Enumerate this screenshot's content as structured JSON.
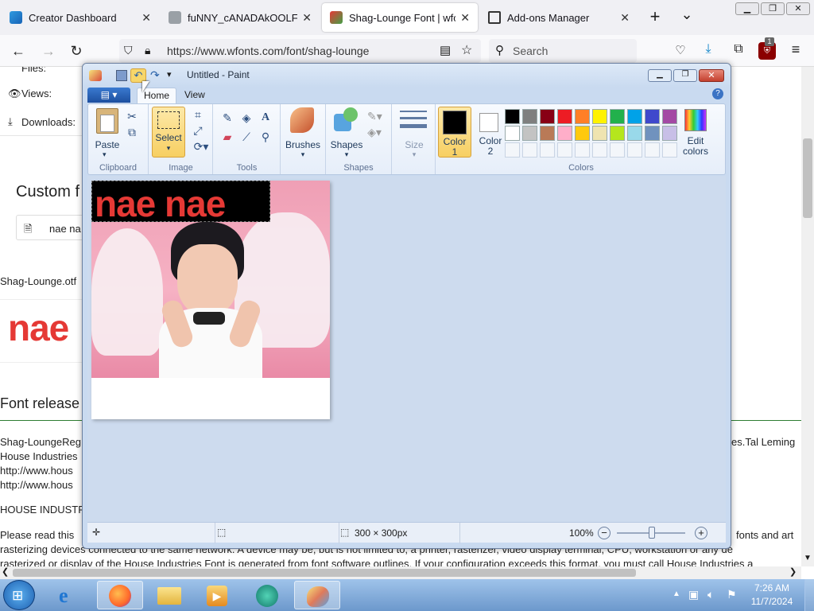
{
  "browser": {
    "tabs": [
      {
        "label": "Creator Dashboard",
        "icon": "windows-icon",
        "active": false
      },
      {
        "label": "fuNNY_cANADAkOOLFEVE",
        "icon": "page-icon",
        "active": false
      },
      {
        "label": "Shag-Lounge Font | wfont",
        "icon": "wfonts-icon",
        "active": true
      },
      {
        "label": "Add-ons Manager",
        "icon": "puzzle-icon",
        "active": false
      }
    ],
    "new_tab": "+",
    "tab_list": "⌄",
    "url": "https://www.wfonts.com/font/shag-lounge",
    "search_placeholder": "Search",
    "extension_badge": "1"
  },
  "page": {
    "files_label": "Files:",
    "views_label": "Views:",
    "downloads_label": "Downloads:",
    "custom_heading": "Custom f",
    "preview_input": "nae na",
    "file_name": "Shag-Lounge.otf",
    "preview_big": "nae",
    "release_heading": "Font release",
    "lines": [
      "Shag-LoungeReg",
      "House Industries",
      "http://www.hous",
      "http://www.hous",
      "HOUSE INDUSTR",
      "Please read this",
      "rasterizing devices connected to the same network. A device may be, but is not limited to, a printer, rasterizer, video display terminal, CPU, workstation or any de",
      "rasterized or display of the House Industries Font is generated from font software outlines. If your configuration exceeds this format, you must call House Industries a"
    ],
    "right_fragment_1": "es.Tal Leming",
    "right_fragment_2": "fonts and art"
  },
  "paint": {
    "title": "Untitled - Paint",
    "tabs": [
      "Home",
      "View"
    ],
    "clipboard": {
      "paste": "Paste",
      "group": "Clipboard"
    },
    "image": {
      "select": "Select",
      "group": "Image"
    },
    "tools": {
      "group": "Tools"
    },
    "brushes": "Brushes",
    "shapes": {
      "label": "Shapes",
      "group": "Shapes"
    },
    "size": "Size",
    "color1": "Color\n1",
    "color1_a": "Color",
    "color1_b": "1",
    "color2_a": "Color",
    "color2_b": "2",
    "edit_colors_a": "Edit",
    "edit_colors_b": "colors",
    "colors_group": "Colors",
    "palette_row1": [
      "#000000",
      "#7f7f7f",
      "#880015",
      "#ed1c24",
      "#ff7f27",
      "#fff200",
      "#22b14c",
      "#00a2e8",
      "#3f48cc",
      "#a349a4"
    ],
    "palette_row2": [
      "#ffffff",
      "#c3c3c3",
      "#b97a57",
      "#ffaec9",
      "#ffc90e",
      "#efe4b0",
      "#b5e61d",
      "#99d9ea",
      "#7092be",
      "#c8bfe7"
    ],
    "canvas_text": "nae nae",
    "status_size": "300 × 300px",
    "zoom": "100%"
  },
  "taskbar": {
    "time": "7:26 AM",
    "date": "11/7/2024"
  }
}
